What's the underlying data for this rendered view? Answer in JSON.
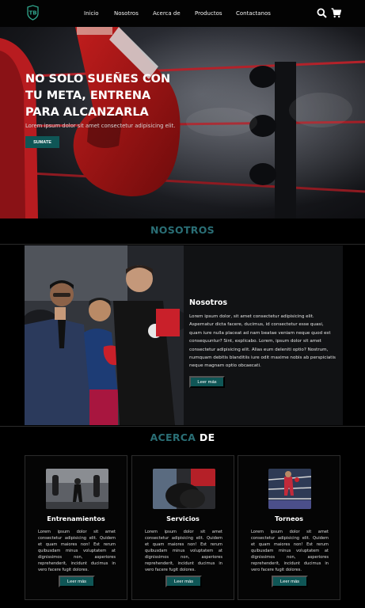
{
  "nav": {
    "links": [
      "Inicio",
      "Nosotros",
      "Acerca de",
      "Productos",
      "Contactanos"
    ],
    "icons": [
      "logo-icon",
      "search-icon",
      "cart-icon"
    ]
  },
  "hero": {
    "title": "NO SOLO SUEÑES CON TU META, ENTRENA PARA ALCANZARLA",
    "subtitle": "Lorem ipsum dolor sit amet consectetur adipisicing elit.",
    "button": "SUMATE"
  },
  "nosotros": {
    "section_title": "NOSOTROS",
    "heading": "Nosotros",
    "body": "Lorem ipsum dolor, sit amet consectetur adipisicing elit. Aspernatur dicta facere, ducimus, id consectetur esse quasi, quam iure nulla placeat ad nam beatae veniam neque quod est consequuntur? Sint, explicabo. Lorem, ipsum dolor sit amet consectetur adipisicing elit. Alias eum deleniti optio? Nostrum, numquam debitis blanditiis iure odit maxime nobis ab perspiciatis neque magnam optio obcaecati.",
    "button": "Leer más"
  },
  "acerca": {
    "title_a": "ACERCA",
    "title_b": " DE",
    "cards": [
      {
        "title": "Entrenamientos",
        "body": "Lorem ipsum dolor sit amet consectetur adipisicing elit. Quidem et quam maiores non! Est rerum quibusdam minus voluptatem at dignissimos non, asperiores reprehenderit, incidunt ducimus in vero facere fugit dolores.",
        "button": "Leer más"
      },
      {
        "title": "Servicios",
        "body": "Lorem ipsum dolor sit amet consectetur adipisicing elit. Quidem et quam maiores non! Est rerum quibusdam minus voluptatem at dignissimos non, asperiores reprehenderit, incidunt ducimus in vero facere fugit dolores.",
        "button": "Leer más"
      },
      {
        "title": "Torneos",
        "body": "Lorem ipsum dolor sit amet consectetur adipisicing elit. Quidem et quam maiores non! Est rerum quibusdam minus voluptatem at dignissimos non, asperiores reprehenderit, incidunt ducimus in vero facere fugit dolores.",
        "button": "Leer más"
      }
    ]
  },
  "colors": {
    "accent": "#0f5656",
    "title_accent": "#2a6e75",
    "background": "#000000"
  }
}
